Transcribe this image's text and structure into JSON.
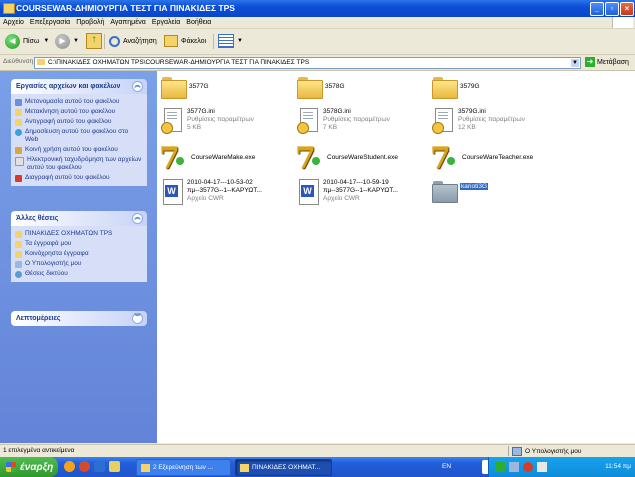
{
  "window": {
    "title": "COURSEWAR-ΔΗΜΙΟΥΡΓΙΑ ΤΕΣΤ ΓΙΑ ΠΙΝΑΚΙΔΕΣ TPS",
    "controls": [
      "minimize",
      "maximize",
      "close"
    ]
  },
  "menu": {
    "items": [
      "Αρχείο",
      "Επεξεργασία",
      "Προβολή",
      "Αγαπημένα",
      "Εργαλεία",
      "Βοήθεια"
    ]
  },
  "toolbar": {
    "back_label": "Πίσω",
    "search_label": "Αναζήτηση",
    "folders_label": "Φάκελοι"
  },
  "address": {
    "label": "Διεύθυνση",
    "value": "C:\\ΠΙΝΑΚΙΔΕΣ ΟΧΗΜΑΤΩΝ TPS\\COURSEWAR-ΔΗΜΙΟΥΡΓΙΑ ΤΕΣΤ ΓΙΑ ΠΙΝΑΚΙΔΕΣ TPS",
    "go_label": "Μετάβαση"
  },
  "left_pane": {
    "tasks": {
      "title": "Εργασίες αρχείων και φακέλων",
      "items": [
        "Μετονομασία αυτού του φακέλου",
        "Μετακίνηση αυτού του φακέλου",
        "Αντιγραφή αυτού του φακέλου",
        "Δημοσίευση αυτού του φακέλου στο Web",
        "Κοινή χρήση αυτού του φακέλου",
        "Ηλεκτρονική ταχυδρόμηση των αρχείων αυτού του φακέλου",
        "Διαγραφή αυτού του φακέλου"
      ]
    },
    "places": {
      "title": "Άλλες θέσεις",
      "items": [
        "ΠΙΝΑΚΙΔΕΣ ΟΧΗΜΑΤΩΝ TPS",
        "Τα έγγραφά μου",
        "Κοινόχρηστα έγγραφα",
        "Ο Υπολογιστής μου",
        "Θέσεις δικτύου"
      ]
    },
    "details": {
      "title": "Λεπτομέρειες"
    }
  },
  "files": [
    {
      "name": "3577G",
      "type": "folder"
    },
    {
      "name": "3578G",
      "type": "folder"
    },
    {
      "name": "3579G",
      "type": "folder"
    },
    {
      "name": "3577G.ini",
      "line2": "Ρυθμίσεις παραμέτρων",
      "line3": "5 KB",
      "type": "ini"
    },
    {
      "name": "3578G.ini",
      "line2": "Ρυθμίσεις παραμέτρων",
      "line3": "7 KB",
      "type": "ini"
    },
    {
      "name": "3579G.ini",
      "line2": "Ρυθμίσεις παραμέτρων",
      "line3": "12 KB",
      "type": "ini"
    },
    {
      "name": "CourseWareMake.exe",
      "type": "exe"
    },
    {
      "name": "CourseWareStudent.exe",
      "type": "exe"
    },
    {
      "name": "CourseWareTeacher.exe",
      "type": "exe"
    },
    {
      "name": "2010-04-17---10-53-02",
      "line2": "πμ--3577G--1--ΚΑΡΥΩΤ...",
      "line3": "Αρχείο CWR",
      "type": "cwr"
    },
    {
      "name": "2010-04-17---10-59-19",
      "line2": "πμ--3577G--1--ΚΑΡΥΩΤ...",
      "line3": "Αρχείο CWR",
      "type": "cwr"
    },
    {
      "name": "karioti3G",
      "type": "folder-selected"
    }
  ],
  "status": {
    "left": "1 επιλεγμένα αντικείμενα",
    "right": "Ο Υπολογιστής μου"
  },
  "taskbar": {
    "start_label": "έναρξη",
    "tasks": [
      "2 Εξερεύνηση των ...",
      "ΠΙΝΑΚΙΔΕΣ ΟΧΗΜΑΤ..."
    ],
    "lang": "EN",
    "clock": "11:54 πμ",
    "tray_brand": "nero"
  }
}
